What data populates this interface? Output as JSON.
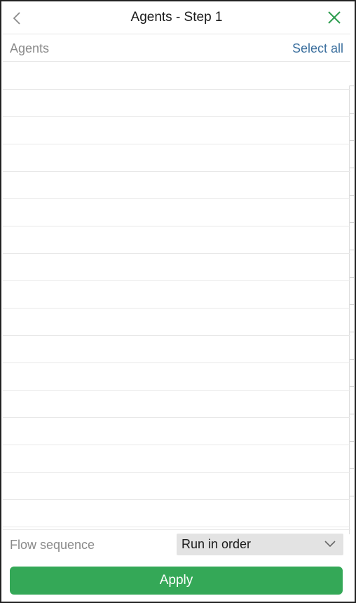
{
  "header": {
    "title": "Agents - Step 1",
    "back_icon": "chevron-left-icon",
    "close_icon": "close-icon"
  },
  "agents_section": {
    "label": "Agents",
    "select_all_label": "Select all",
    "rows": [
      "",
      "",
      "",
      "",
      "",
      "",
      "",
      "",
      "",
      "",
      "",
      "",
      "",
      "",
      "",
      "",
      ""
    ]
  },
  "flow": {
    "label": "Flow sequence",
    "selected": "Run in order",
    "dropdown_icon": "chevron-down-icon"
  },
  "apply": {
    "label": "Apply"
  },
  "colors": {
    "accent_green": "#34a857",
    "close_green": "#2e9d4f",
    "link_blue": "#3b6f9e",
    "muted_text": "#8a8a8a"
  }
}
